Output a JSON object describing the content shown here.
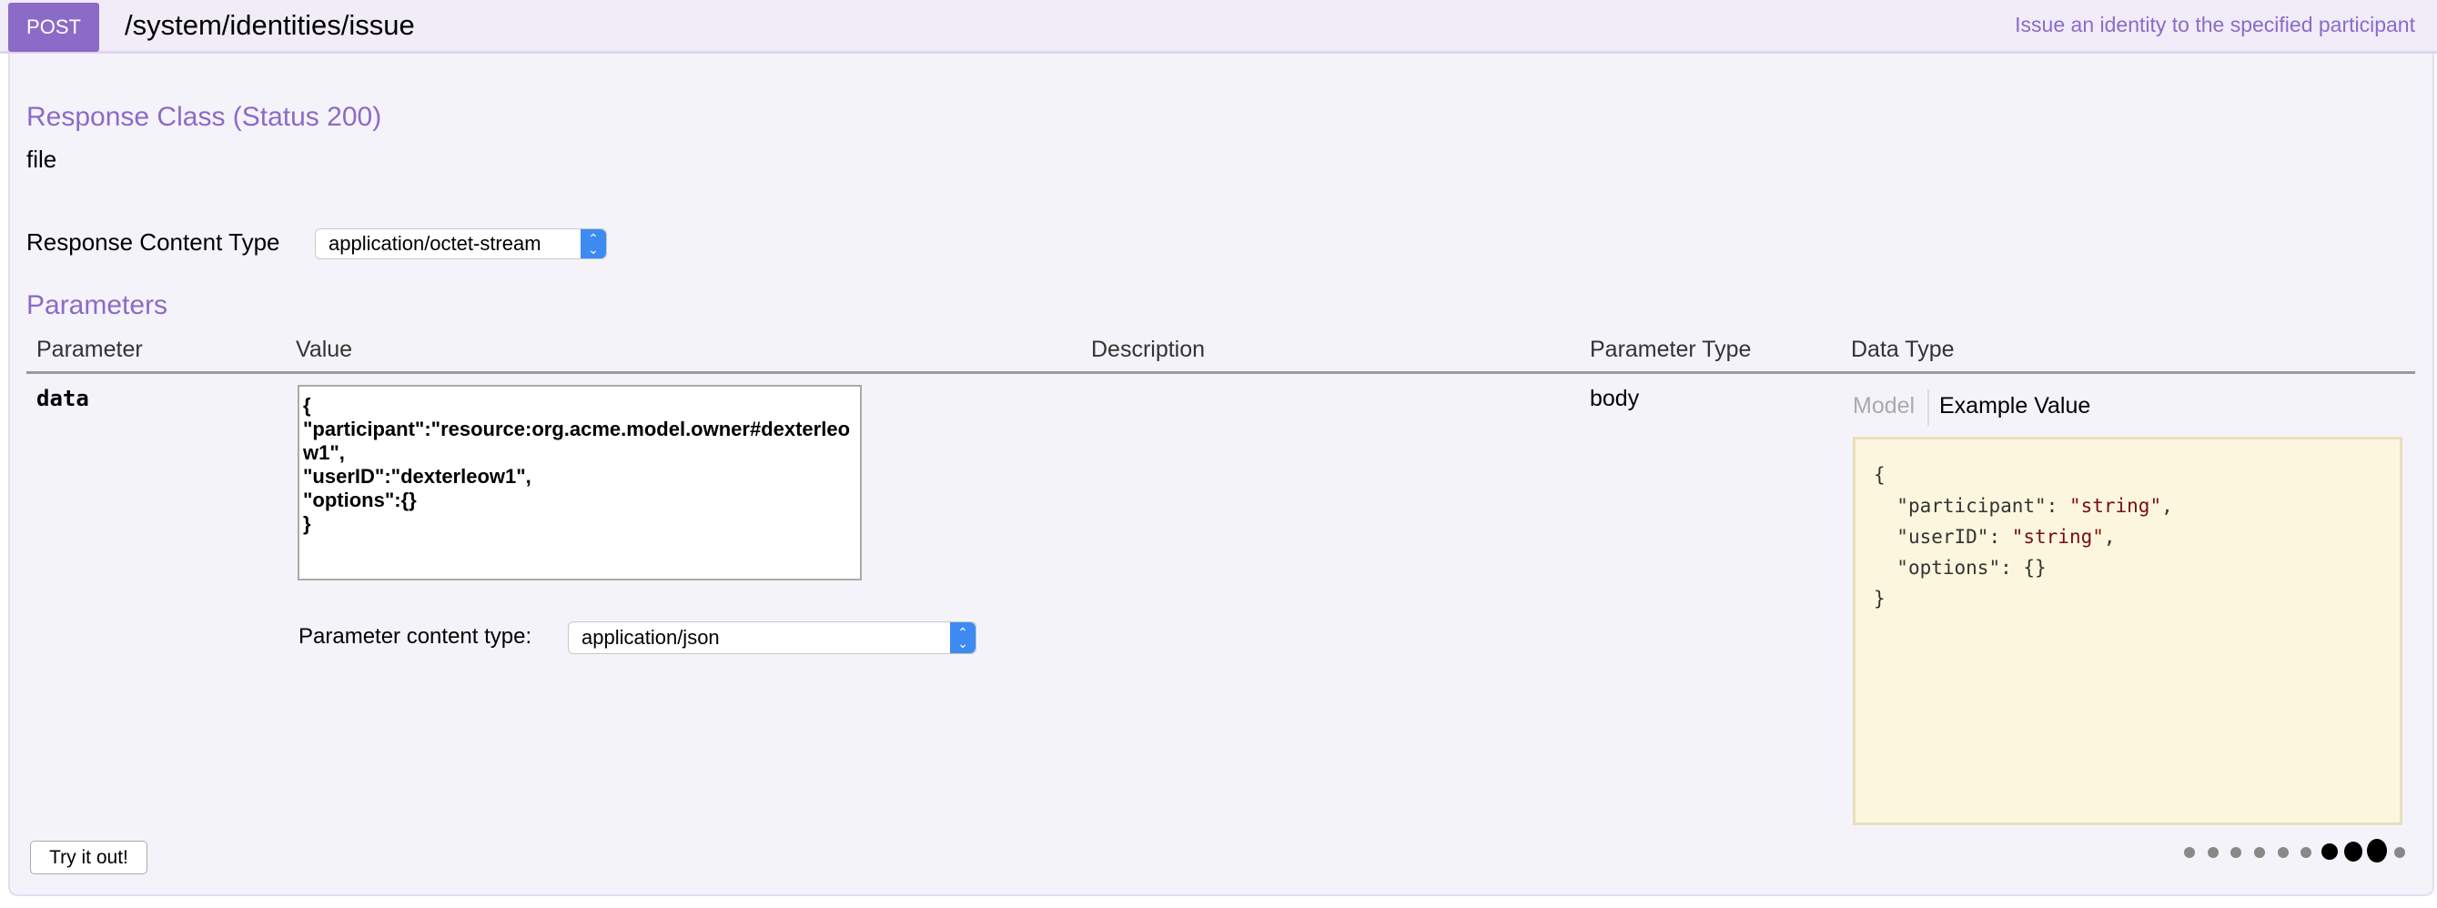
{
  "header": {
    "method": "POST",
    "path": "/system/identities/issue",
    "summary": "Issue an identity to the specified participant"
  },
  "response": {
    "heading": "Response Class (Status 200)",
    "class": "file",
    "content_type_label": "Response Content Type",
    "content_type_value": "application/octet-stream"
  },
  "parameters": {
    "heading": "Parameters",
    "columns": [
      "Parameter",
      "Value",
      "Description",
      "Parameter Type",
      "Data Type"
    ],
    "row": {
      "name": "data",
      "value": "{\n\"participant\":\"resource:org.acme.model.owner#dexterleow1\",\n\"userID\":\"dexterleow1\",\n\"options\":{}\n}",
      "param_type": "body",
      "content_type_label": "Parameter content type:",
      "content_type_value": "application/json",
      "tabs": [
        "Model",
        "Example Value"
      ],
      "example": {
        "open": "{",
        "l1k": "\"participant\": ",
        "l1v": "\"string\"",
        "l2k": "\"userID\": ",
        "l2v": "\"string\"",
        "l3": "\"options\": {}",
        "close": "}"
      }
    }
  },
  "try_button": "Try it out!",
  "colors": {
    "accent": "#8b6bc7",
    "example_bg": "#fcf6de"
  }
}
